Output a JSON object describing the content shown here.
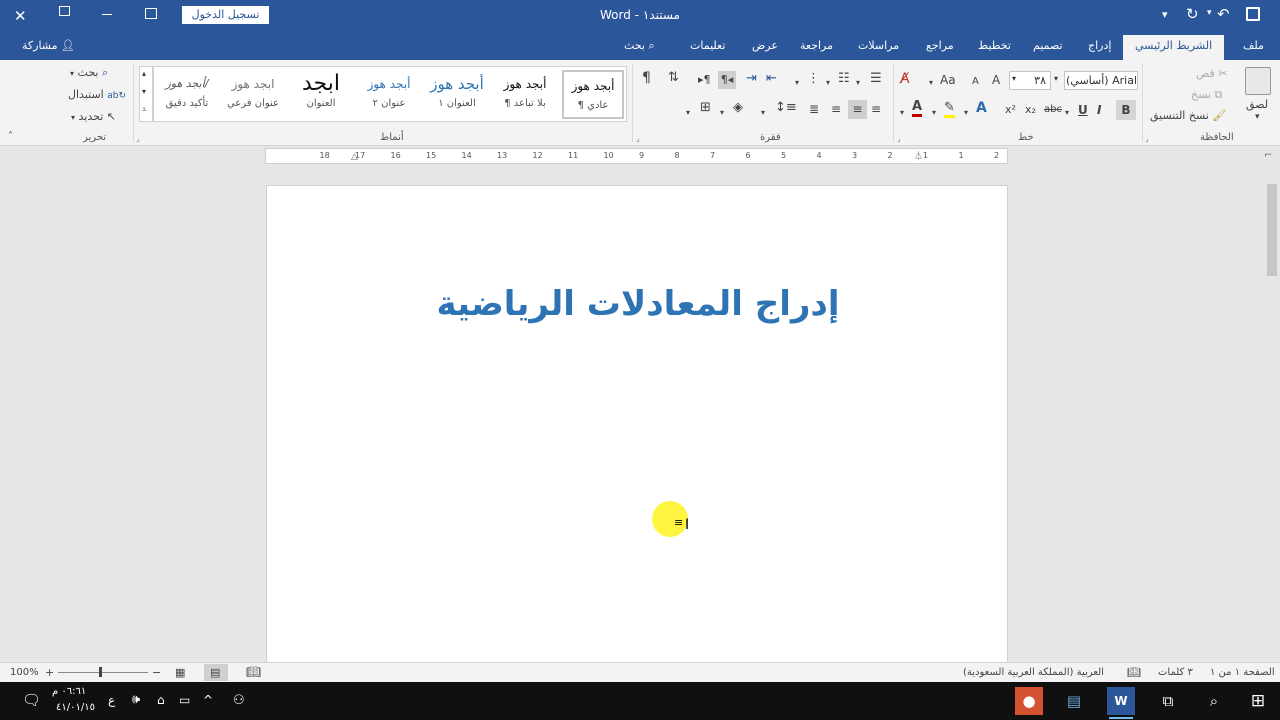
{
  "titlebar": {
    "doc_title": "مستند١",
    "separator": "-",
    "app_name": "Word",
    "signin_label": "تسجيل الدخول",
    "qat_dropdown": "▾"
  },
  "tabs": [
    {
      "label": "ملف"
    },
    {
      "label": "الشريط الرئيسي",
      "active": true
    },
    {
      "label": "إدراج"
    },
    {
      "label": "تصميم"
    },
    {
      "label": "تخطيط"
    },
    {
      "label": "مراجع"
    },
    {
      "label": "مراسلات"
    },
    {
      "label": "مراجعة"
    },
    {
      "label": "عرض"
    },
    {
      "label": "تعليمات"
    },
    {
      "label": "بحث"
    }
  ],
  "share_label": "مشاركة",
  "clipboard": {
    "paste": "لصق",
    "cut": "قص",
    "copy": "نسخ",
    "format_painter": "نسخ التنسيق",
    "group": "الحافظة"
  },
  "font": {
    "name": "Arial (أساسي)",
    "size": "٣٨",
    "group": "خط",
    "bold": "B",
    "italic": "I",
    "underline": "U",
    "strike": "abc",
    "sub": "x₂",
    "sup": "x²",
    "grow": "A",
    "shrink": "A",
    "change_case": "Aa"
  },
  "paragraph": {
    "group": "فقرة"
  },
  "styles": {
    "group": "أنماط",
    "items": [
      {
        "sample": "أبجد هوز",
        "name": "¶ عادي"
      },
      {
        "sample": "أبجد هوز",
        "name": "¶ بلا تباعد"
      },
      {
        "sample": "أبجد هوز",
        "name": "العنوان ١"
      },
      {
        "sample": "أبجد هوز",
        "name": "عنوان ٢"
      },
      {
        "sample": "ابجد",
        "name": "العنوان"
      },
      {
        "sample": "ابجد هوز",
        "name": "عنوان فرعي"
      },
      {
        "sample": "أبجد هوز/",
        "name": "تأكيد دقيق"
      }
    ]
  },
  "editing": {
    "find": "بحث",
    "replace": "استبدال",
    "select": "تحديد",
    "group": "تحرير"
  },
  "ruler": {
    "numbers": [
      "2",
      "1",
      "1",
      "2",
      "3",
      "4",
      "5",
      "6",
      "7",
      "8",
      "9",
      "10",
      "11",
      "12",
      "13",
      "14",
      "15",
      "16",
      "17",
      "18"
    ]
  },
  "document": {
    "title": "إدراج المعادلات الرياضية"
  },
  "status": {
    "page": "الصفحة ١ من ١",
    "words": "٣ كلمات",
    "language": "العربية (المملكة العربية السعودية)",
    "zoom": "100%"
  },
  "taskbar": {
    "time": "٠٦:٦١ م",
    "date": "٤١/٠١/١٥",
    "lang": "ع"
  },
  "colors": {
    "accent": "#2b579a",
    "title_blue": "#2e74b5",
    "highlight": "#fff200",
    "font_color": "#c00000"
  }
}
